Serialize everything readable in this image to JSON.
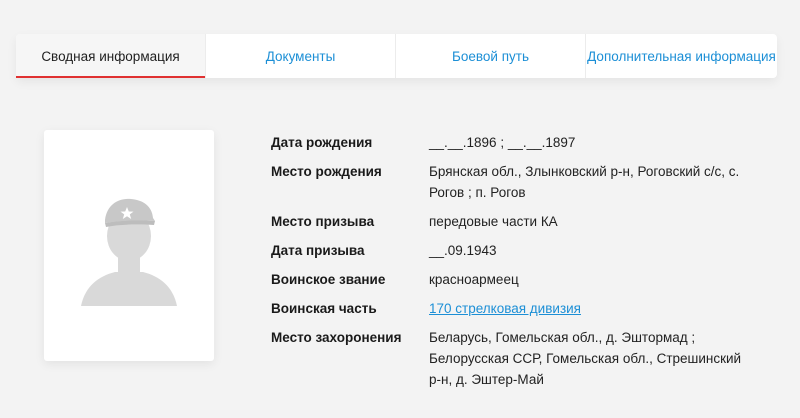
{
  "tabs": [
    {
      "label": "Сводная информация",
      "active": true
    },
    {
      "label": "Документы",
      "active": false
    },
    {
      "label": "Боевой путь",
      "active": false
    },
    {
      "label": "Дополнительная информация",
      "active": false
    }
  ],
  "photo": {
    "icon": "soldier-silhouette-placeholder-icon",
    "fill_color": "#d9d9d9",
    "star_color": "#ffffff"
  },
  "info": {
    "birth_date": {
      "label": "Дата рождения",
      "value": "__.__.1896 ; __.__.1897"
    },
    "birth_place": {
      "label": "Место рождения",
      "value": "Брянская обл., Злынковский р-н, Роговский с/с, с. Рогов ; п. Рогов"
    },
    "draft_place": {
      "label": "Место призыва",
      "value": "передовые части КА"
    },
    "draft_date": {
      "label": "Дата призыва",
      "value": "__.09.1943"
    },
    "rank": {
      "label": "Воинское звание",
      "value": "красноармеец"
    },
    "unit": {
      "label": "Воинская часть",
      "value": "170 стрелковая дивизия"
    },
    "burial_place": {
      "label": "Место захоронения",
      "value": "Беларусь, Гомельская обл., д. Эштормад ; Белорусская ССР, Гомельская обл., Стрешинский р-н, д. Эштер-Май"
    }
  },
  "colors": {
    "accent": "#1c8fd6",
    "active_underline": "#e03131",
    "background": "#f3f3f3"
  }
}
